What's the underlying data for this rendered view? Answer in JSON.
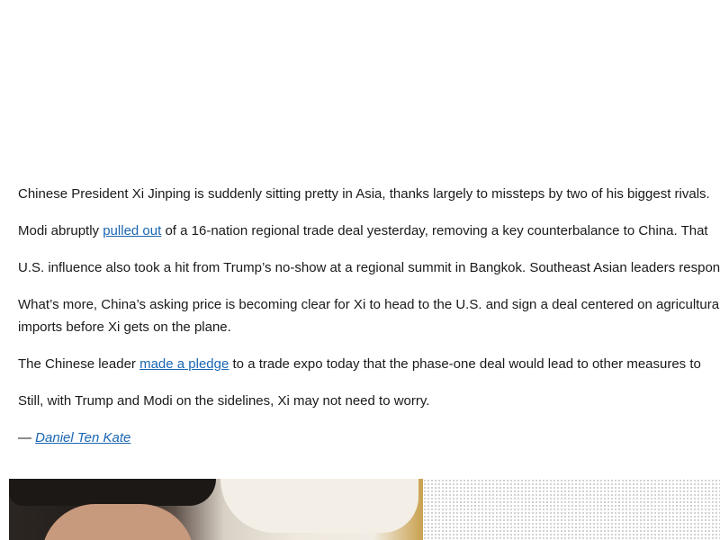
{
  "article": {
    "p1": "Chinese President Xi Jinping is suddenly sitting pretty in Asia, thanks largely to missteps by two of his biggest rivals.",
    "p2": {
      "before": "Modi abruptly ",
      "link": "pulled out",
      "after": " of a 16-nation regional trade deal yesterday, removing a key counterbalance to China. That"
    },
    "p3": "U.S. influence also took a hit from Trump’s no-show at a regional summit in Bangkok. Southeast Asian leaders responded",
    "p4": {
      "line1": "What’s more, China’s asking price is becoming clear for Xi to head to the U.S. and sign a deal centered on agricultural",
      "line2": "imports before Xi gets on the plane."
    },
    "p5": {
      "before": "The Chinese leader ",
      "link": "made a pledge",
      "after": " to a trade expo today that the phase-one deal would lead to other measures to"
    },
    "p6": "Still, with Trump and Modi on the sidelines, Xi may not need to worry.",
    "byline": {
      "dash": "— ",
      "author": "Daniel Ten Kate"
    }
  },
  "colors": {
    "link": "#1a66b3",
    "text": "#1a1a1a"
  }
}
